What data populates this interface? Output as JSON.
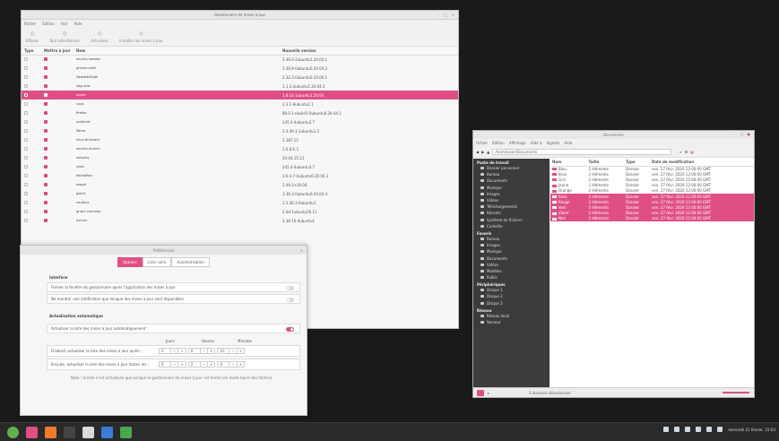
{
  "update_manager": {
    "title": "Gestionnaire de mises à jour",
    "menu": [
      "Fichier",
      "Édition",
      "Voir",
      "Aide"
    ],
    "toolbar": [
      {
        "label": "Effacer",
        "icon": "clear-icon"
      },
      {
        "label": "Tout sélectionner",
        "icon": "select-all-icon"
      },
      {
        "label": "Actualiser",
        "icon": "refresh-icon"
      },
      {
        "label": "Installer les mises à jour",
        "icon": "install-icon"
      }
    ],
    "columns": [
      "Type",
      "Mettre à jour",
      "Nom",
      "Nouvelle version"
    ],
    "rows": [
      {
        "name": "ubuntu-session",
        "desc": "",
        "version": "3.36.0-2ubuntu1.20.04.1"
      },
      {
        "name": "gnome-shell",
        "desc": "",
        "version": "3.36.9-0ubuntu0.20.04.2"
      },
      {
        "name": "libwebkit2gtk",
        "desc": "",
        "version": "2.32.3-0ubuntu0.20.04.1"
      },
      {
        "name": "xdg-utils",
        "desc": "",
        "version": "1.1.3-2ubuntu1.20.04.2"
      },
      {
        "name": "locale",
        "desc": "",
        "version": "1.8.14-1ubuntu1.20.04"
      },
      {
        "name": "cups",
        "desc": "",
        "version": "2.3.1-9ubuntu1.1"
      },
      {
        "name": "firefox",
        "desc": "",
        "version": "89.0.1+build1-0ubuntu0.20.04.1"
      },
      {
        "name": "systemd",
        "desc": "",
        "version": "245.4-4ubuntu3.7"
      },
      {
        "name": "libnss",
        "desc": "",
        "version": "2:3.49.1-1ubuntu1.5"
      },
      {
        "name": "linux-firmware",
        "desc": "",
        "version": "1.187.12"
      },
      {
        "name": "ubuntu-drivers",
        "desc": "",
        "version": "1:0.8.6.3"
      },
      {
        "name": "ubiquity",
        "desc": "",
        "version": "20.04.15.13"
      },
      {
        "name": "udev",
        "desc": "",
        "version": "245.4-4ubuntu3.7"
      },
      {
        "name": "libreoffice",
        "desc": "",
        "version": "1:6.4.7-0ubuntu0.20.04.1"
      },
      {
        "name": "snapd",
        "desc": "",
        "version": "2.49.2+20.04"
      },
      {
        "name": "gdm3",
        "desc": "",
        "version": "3.36.3-0ubuntu0.20.04.4"
      },
      {
        "name": "nautilus",
        "desc": "",
        "version": "1:3.36.3-0ubuntu1"
      },
      {
        "name": "grub2-common",
        "desc": "",
        "version": "2.04-1ubuntu26.11"
      },
      {
        "name": "evince",
        "desc": "",
        "version": "3.36.10-0ubuntu1"
      }
    ],
    "selected_row": 4
  },
  "preferences": {
    "title": "Préférences",
    "tabs": [
      "Options",
      "Liste noire",
      "Automatisation"
    ],
    "active_tab": 0,
    "interface_header": "Interface",
    "interface_rows": [
      {
        "label": "Fermer la fenêtre du gestionnaire après l'application des mises à jour",
        "on": false
      },
      {
        "label": "Ne montrer une notification que lorsque des mises à jour sont disponibles",
        "on": false
      }
    ],
    "auto_header": "Actualisation automatique",
    "auto_row": {
      "label": "Actualiser la liste des mises à jour automatiquement :",
      "on": true
    },
    "interval_headers": [
      "Jours",
      "Heures",
      "Minutes"
    ],
    "interval_rows": [
      {
        "label": "D'abord, actualiser la liste des mises à jour après :",
        "values": [
          "0",
          "0",
          "10"
        ]
      },
      {
        "label": "Ensuite, actualiser la liste des mises à jour toutes les :",
        "values": [
          "0",
          "2",
          "0"
        ]
      }
    ],
    "note": "Note : la liste n'est actualisée que lorsque le gestionnaire de mises à jour est fermé (en mode barre des tâches)."
  },
  "file_manager": {
    "title": "Documents",
    "menu": [
      "Fichier",
      "Édition",
      "Affichage",
      "Aller à",
      "Signets",
      "Aide"
    ],
    "path": "/home/user/Documents",
    "sidebar": [
      {
        "header": "Poste de travail",
        "items": [
          "Dossier personnel",
          "Bureau",
          "Documents",
          "Musique",
          "Images",
          "Vidéos",
          "Téléchargements",
          "Récents",
          "Système de fichiers",
          "Corbeille"
        ]
      },
      {
        "header": "Favoris",
        "items": [
          "Bureau",
          "Images",
          "Musique",
          "Documents",
          "Vidéos",
          "Modèles",
          "Public"
        ]
      },
      {
        "header": "Périphériques",
        "items": [
          "Disque 1",
          "Disque 2",
          "Disque 3"
        ]
      },
      {
        "header": "Réseau",
        "items": [
          "Réseau local",
          "Serveur"
        ]
      }
    ],
    "columns": [
      "Nom",
      "Taille",
      "Type",
      "Date de modification"
    ],
    "files": [
      {
        "name": "Bleu",
        "size": "2 éléments",
        "type": "Dossier",
        "date": "ven. 27 févr. 2020 12:00:00 GMT",
        "sel": false
      },
      {
        "name": "Brun",
        "size": "2 éléments",
        "type": "Dossier",
        "date": "ven. 27 févr. 2020 12:00:00 GMT",
        "sel": false
      },
      {
        "name": "Gris",
        "size": "2 éléments",
        "type": "Dossier",
        "date": "ven. 27 févr. 2020 12:00:00 GMT",
        "sel": false
      },
      {
        "name": "Jaune",
        "size": "2 éléments",
        "type": "Dossier",
        "date": "ven. 27 févr. 2020 12:00:00 GMT",
        "sel": false
      },
      {
        "name": "Orange",
        "size": "2 éléments",
        "type": "Dossier",
        "date": "ven. 27 févr. 2020 12:00:00 GMT",
        "sel": false
      },
      {
        "name": "Rose",
        "size": "2 éléments",
        "type": "Dossier",
        "date": "ven. 27 févr. 2020 12:00:00 GMT",
        "sel": true
      },
      {
        "name": "Rouge",
        "size": "2 éléments",
        "type": "Dossier",
        "date": "ven. 27 févr. 2020 12:00:00 GMT",
        "sel": true
      },
      {
        "name": "Vert",
        "size": "2 éléments",
        "type": "Dossier",
        "date": "ven. 27 févr. 2020 12:00:00 GMT",
        "sel": true
      },
      {
        "name": "Violet",
        "size": "2 éléments",
        "type": "Dossier",
        "date": "ven. 27 févr. 2020 12:00:00 GMT",
        "sel": true
      },
      {
        "name": "Noir",
        "size": "2 éléments",
        "type": "Dossier",
        "date": "ven. 27 févr. 2020 12:00:00 GMT",
        "sel": true
      }
    ],
    "status": "5 dossiers sélectionnés"
  },
  "taskbar": {
    "clock": "mercredi 21 février, 15:03",
    "apps": [
      {
        "name": "menu-icon",
        "color": "#61b04f"
      },
      {
        "name": "files-icon",
        "color": "#df4f85"
      },
      {
        "name": "firefox-icon",
        "color": "#f07b2f"
      },
      {
        "name": "terminal-icon",
        "color": "#444444"
      },
      {
        "name": "folder-icon",
        "color": "#d9d9d9"
      },
      {
        "name": "window-icon",
        "color": "#3d7bd9"
      },
      {
        "name": "shield-icon",
        "color": "#4aa84e"
      }
    ]
  },
  "colors": {
    "accent": "#df4f85"
  }
}
